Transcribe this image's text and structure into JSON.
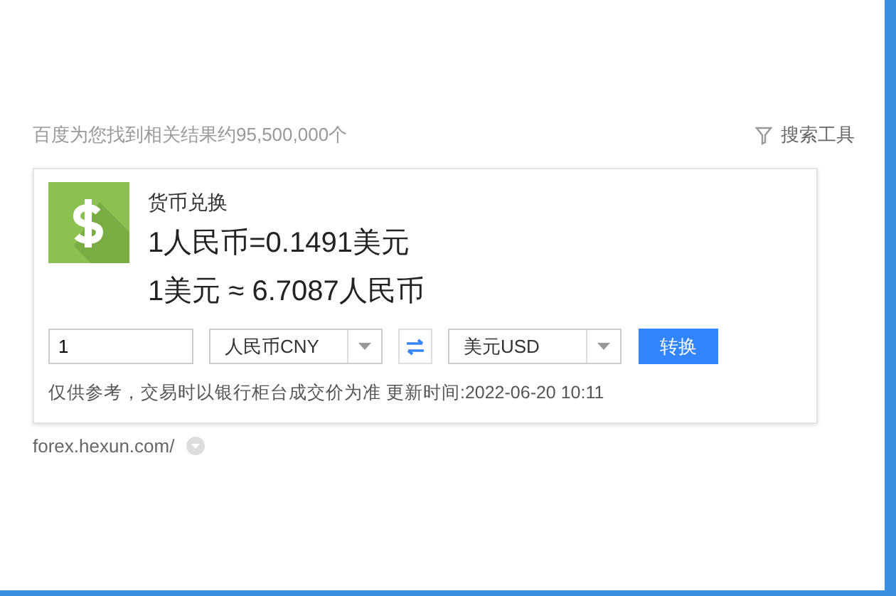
{
  "result_count": "百度为您找到相关结果约95,500,000个",
  "search_tools": {
    "label": "搜索工具"
  },
  "card": {
    "title": "货币兑换",
    "rate_line": "1人民币=0.1491美元",
    "inverse_line": "1美元 ≈ 6.7087人民币",
    "amount": "1",
    "from_currency": "人民币CNY",
    "to_currency": "美元USD",
    "convert_button": "转换",
    "note": "仅供参考，交易时以银行柜台成交价为准 更新时间:2022-06-20 10:11"
  },
  "source_url": "forex.hexun.com/"
}
